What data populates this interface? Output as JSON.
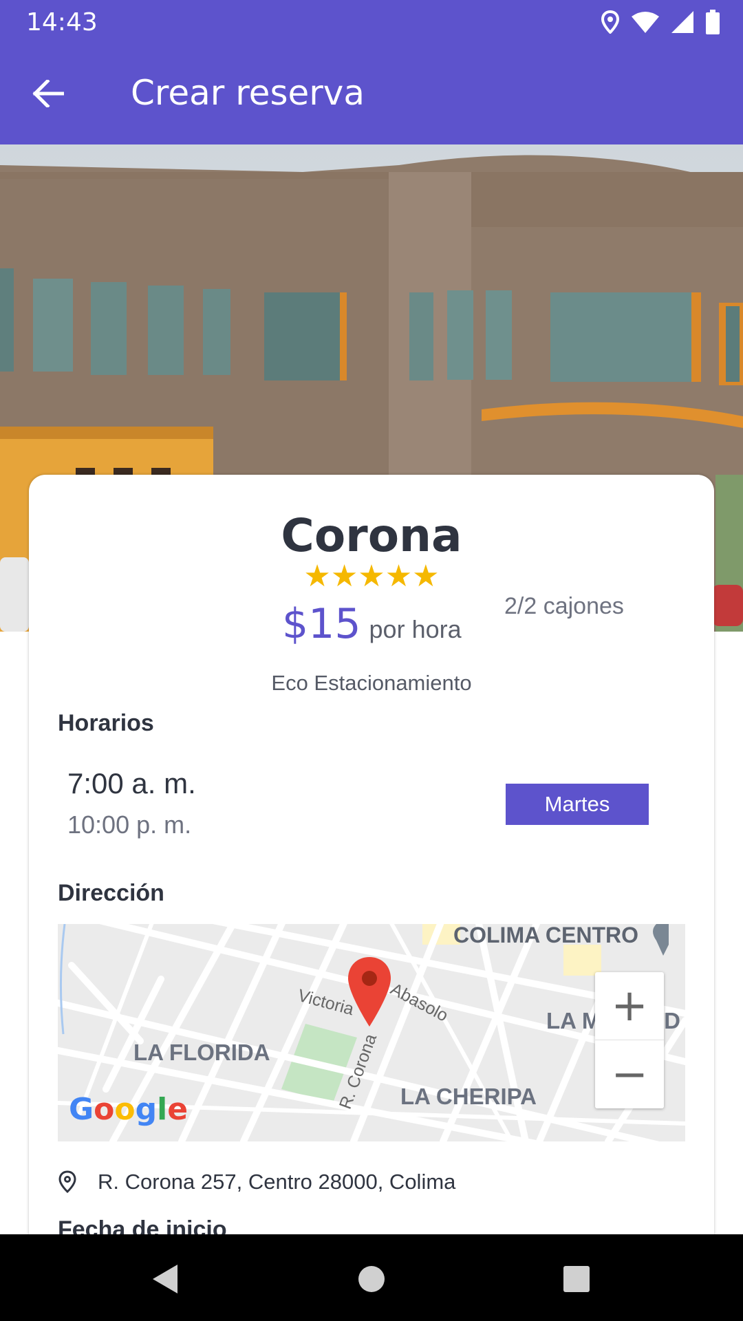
{
  "status_bar": {
    "time": "14:43",
    "icons": [
      "location-icon",
      "wifi-icon",
      "signal-icon",
      "battery-icon"
    ]
  },
  "app_bar": {
    "title": "Crear reserva",
    "back_icon": "arrow-back-icon"
  },
  "parking": {
    "name": "Corona",
    "rating_stars": "★★★★★",
    "rating": 5,
    "price": "$15",
    "price_unit": "por hora",
    "capacity": "2/2 cajones",
    "type": "Eco Estacionamiento"
  },
  "schedule": {
    "title": "Horarios",
    "open": "7:00 a. m.",
    "close": "10:00 p. m.",
    "day": "Martes"
  },
  "address": {
    "title": "Dirección",
    "text": "R. Corona 257, Centro 28000, Colima",
    "map_labels": {
      "centro": "COLIMA CENTRO",
      "florida": "LA FLORIDA",
      "merced": "LA MERCED",
      "cheripa": "LA CHERIPA",
      "street_victoria": "Victoria",
      "street_abasolo": "Abasolo",
      "street_corona": "R. Corona"
    },
    "map_logo": "Google",
    "zoom_in": "+",
    "zoom_out": "−"
  },
  "next_section": {
    "title": "Fecha de inicio"
  },
  "colors": {
    "primary": "#5d53cc",
    "star": "#f5b800",
    "marker": "#ea4335"
  }
}
